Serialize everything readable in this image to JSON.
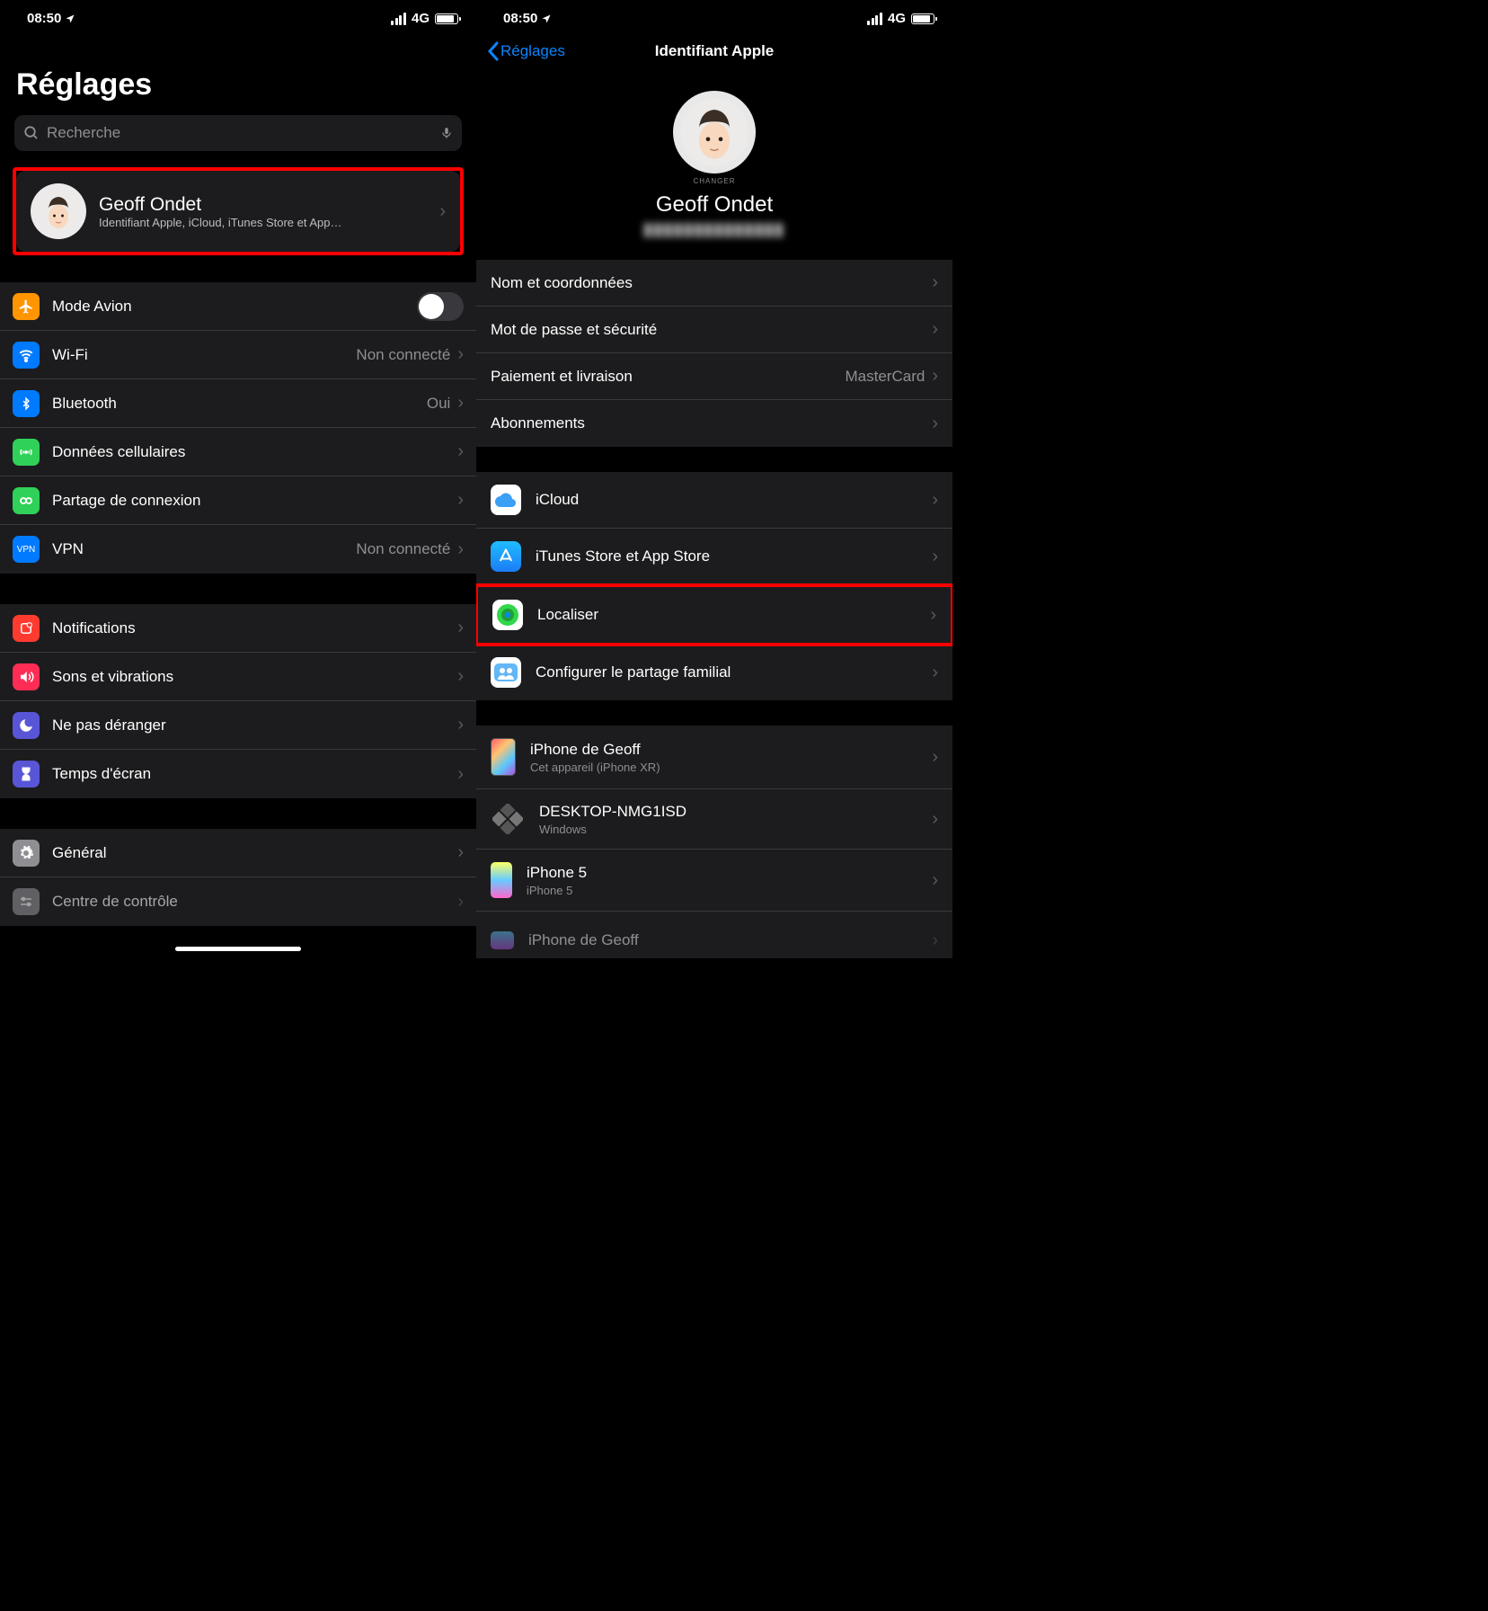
{
  "status": {
    "time": "08:50",
    "network": "4G"
  },
  "left": {
    "title": "Réglages",
    "search_placeholder": "Recherche",
    "profile": {
      "name": "Geoff Ondet",
      "subtitle": "Identifiant Apple, iCloud, iTunes Store et App…"
    },
    "group1": [
      {
        "icon": "airplane",
        "label": "Mode Avion",
        "toggle": false
      },
      {
        "icon": "wifi",
        "label": "Wi-Fi",
        "value": "Non connecté"
      },
      {
        "icon": "bluetooth",
        "label": "Bluetooth",
        "value": "Oui"
      },
      {
        "icon": "cellular",
        "label": "Données cellulaires"
      },
      {
        "icon": "hotspot",
        "label": "Partage de connexion"
      },
      {
        "icon": "vpn",
        "label": "VPN",
        "value": "Non connecté"
      }
    ],
    "group2": [
      {
        "icon": "notifications",
        "label": "Notifications"
      },
      {
        "icon": "sounds",
        "label": "Sons et vibrations"
      },
      {
        "icon": "dnd",
        "label": "Ne pas déranger"
      },
      {
        "icon": "screentime",
        "label": "Temps d'écran"
      }
    ],
    "group3": [
      {
        "icon": "general",
        "label": "Général"
      },
      {
        "icon": "controlcenter",
        "label": "Centre de contrôle"
      }
    ]
  },
  "right": {
    "back": "Réglages",
    "title": "Identifiant Apple",
    "changer": "CHANGER",
    "name": "Geoff Ondet",
    "email_masked": "██████████████",
    "group1": [
      {
        "label": "Nom et coordonnées"
      },
      {
        "label": "Mot de passe et sécurité"
      },
      {
        "label": "Paiement et livraison",
        "value": "MasterCard"
      },
      {
        "label": "Abonnements"
      }
    ],
    "group2": [
      {
        "icon": "icloud",
        "label": "iCloud"
      },
      {
        "icon": "appstore",
        "label": "iTunes Store et App Store"
      },
      {
        "icon": "findmy",
        "label": "Localiser",
        "highlight": true
      },
      {
        "icon": "family",
        "label": "Configurer le partage familial"
      }
    ],
    "devices": [
      {
        "type": "phone",
        "name": "iPhone de Geoff",
        "sub": "Cet appareil (iPhone XR)"
      },
      {
        "type": "desktop",
        "name": "DESKTOP-NMG1ISD",
        "sub": "Windows"
      },
      {
        "type": "oldphone",
        "name": "iPhone 5",
        "sub": "iPhone 5"
      },
      {
        "type": "phone2",
        "name": "iPhone de Geoff",
        "sub": ""
      }
    ]
  }
}
